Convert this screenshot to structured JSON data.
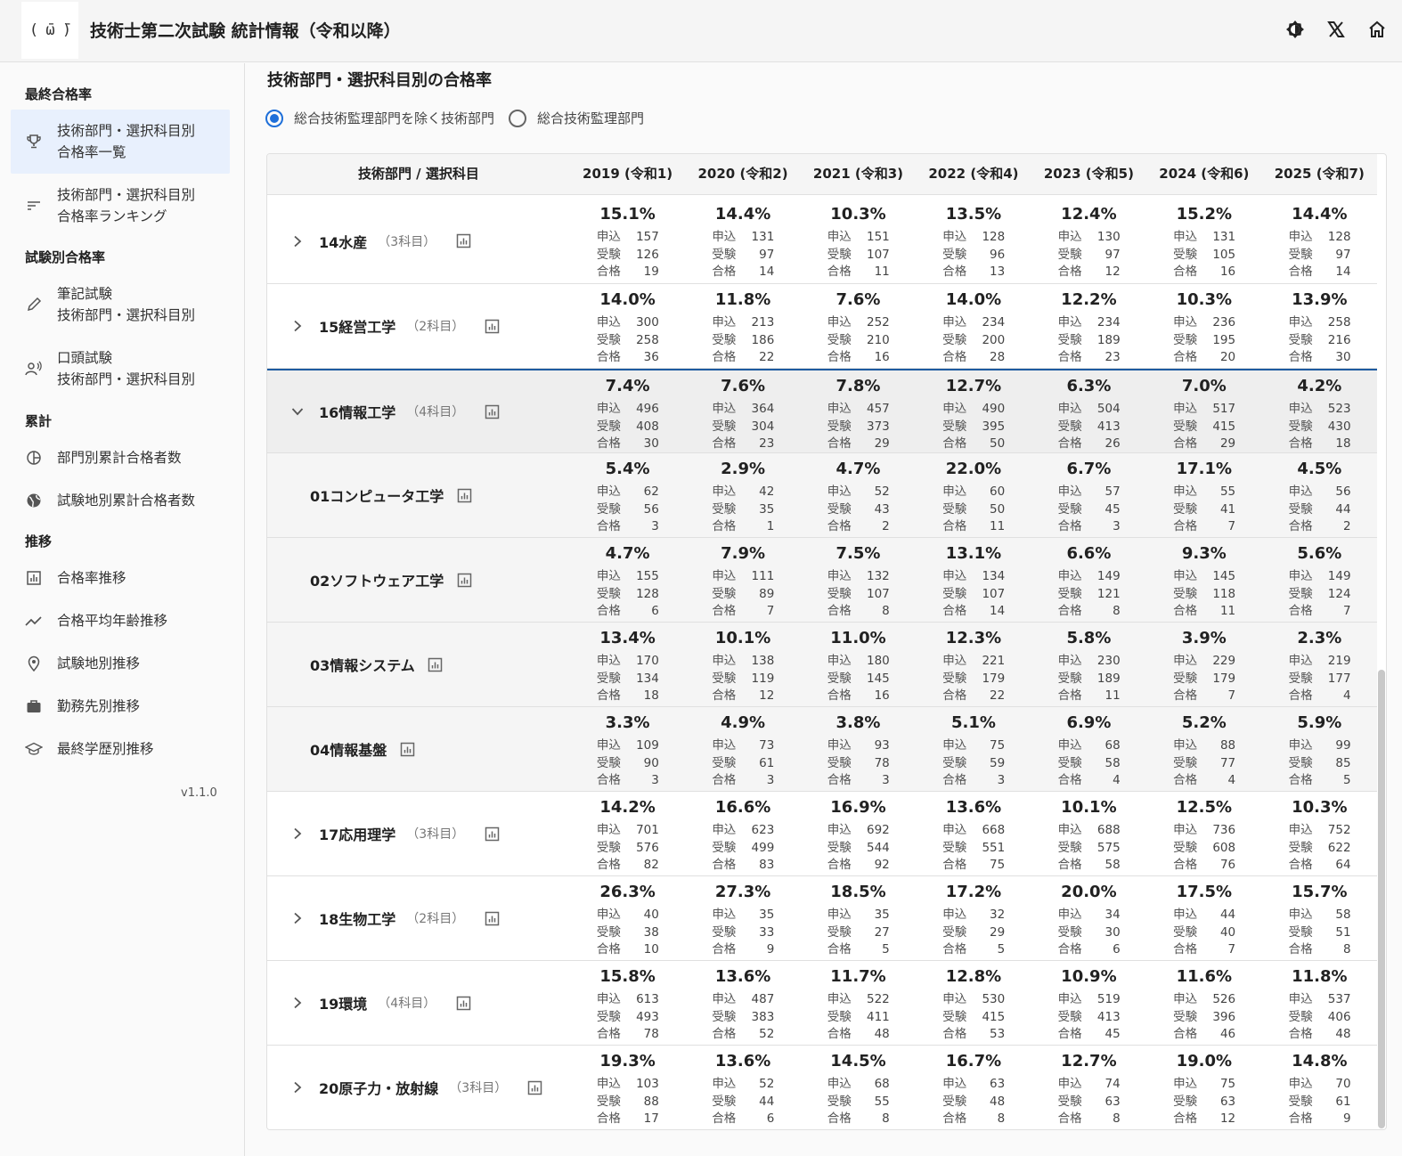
{
  "app": {
    "logo_text": "( ̄ω ̄)",
    "title": "技術士第二次試験 統計情報（令和以降）"
  },
  "appbar_icons": [
    "theme-toggle-icon",
    "x-logo-icon",
    "home-icon"
  ],
  "sidebar": {
    "sections": [
      {
        "label": "最終合格率",
        "items": [
          {
            "icon": "trophy-icon",
            "line1": "技術部門・選択科目別",
            "line2": "合格率一覧",
            "active": true
          },
          {
            "icon": "sort-icon",
            "line1": "技術部門・選択科目別",
            "line2": "合格率ランキング"
          }
        ]
      },
      {
        "label": "試験別合格率",
        "items": [
          {
            "icon": "pencil-icon",
            "line1": "筆記試験",
            "line2": "技術部門・選択科目別"
          },
          {
            "icon": "voice-icon",
            "line1": "口頭試験",
            "line2": "技術部門・選択科目別"
          }
        ]
      },
      {
        "label": "累計",
        "items": [
          {
            "icon": "pie-chart-icon",
            "line1": "部門別累計合格者数"
          },
          {
            "icon": "globe-icon",
            "line1": "試験地別累計合格者数"
          }
        ]
      },
      {
        "label": "推移",
        "items": [
          {
            "icon": "bar-chart-icon",
            "line1": "合格率推移"
          },
          {
            "icon": "trending-icon",
            "line1": "合格平均年齢推移"
          },
          {
            "icon": "location-pin-icon",
            "line1": "試験地別推移"
          },
          {
            "icon": "briefcase-icon",
            "line1": "勤務先別推移"
          },
          {
            "icon": "school-icon",
            "line1": "最終学歴別推移"
          }
        ]
      }
    ],
    "version": "v1.1.0"
  },
  "main": {
    "title": "技術部門・選択科目別の合格率",
    "radios": [
      {
        "label": "総合技術監理部門を除く技術部門",
        "checked": true
      },
      {
        "label": "総合技術監理部門",
        "checked": false
      }
    ]
  },
  "table": {
    "header_name": "技術部門 / 選択科目",
    "years": [
      "2019 (令和1)",
      "2020 (令和2)",
      "2021 (令和3)",
      "2022 (令和4)",
      "2023 (令和5)",
      "2024 (令和6)",
      "2025 (令和7)"
    ],
    "stat_labels": [
      "申込",
      "受験",
      "合格"
    ],
    "rows": [
      {
        "name": "14水産",
        "count": "（3科目）",
        "type": "dept",
        "expanded": false,
        "cells": [
          [
            "15.1%",
            157,
            126,
            19
          ],
          [
            "14.4%",
            131,
            97,
            14
          ],
          [
            "10.3%",
            151,
            107,
            11
          ],
          [
            "13.5%",
            128,
            96,
            13
          ],
          [
            "12.4%",
            130,
            97,
            12
          ],
          [
            "15.2%",
            131,
            105,
            16
          ],
          [
            "14.4%",
            128,
            97,
            14
          ]
        ]
      },
      {
        "name": "15経営工学",
        "count": "（2科目）",
        "type": "dept",
        "expanded": false,
        "cells": [
          [
            "14.0%",
            300,
            258,
            36
          ],
          [
            "11.8%",
            213,
            186,
            22
          ],
          [
            "7.6%",
            252,
            210,
            16
          ],
          [
            "14.0%",
            234,
            200,
            28
          ],
          [
            "12.2%",
            234,
            189,
            23
          ],
          [
            "10.3%",
            236,
            195,
            20
          ],
          [
            "13.9%",
            258,
            216,
            30
          ]
        ]
      },
      {
        "name": "16情報工学",
        "count": "（4科目）",
        "type": "dept",
        "expanded": true,
        "cells": [
          [
            "7.4%",
            496,
            408,
            30
          ],
          [
            "7.6%",
            364,
            304,
            23
          ],
          [
            "7.8%",
            457,
            373,
            29
          ],
          [
            "12.7%",
            490,
            395,
            50
          ],
          [
            "6.3%",
            504,
            413,
            26
          ],
          [
            "7.0%",
            517,
            415,
            29
          ],
          [
            "4.2%",
            523,
            430,
            18
          ]
        ]
      },
      {
        "name": "01コンピュータ工学",
        "type": "child",
        "cells": [
          [
            "5.4%",
            62,
            56,
            3
          ],
          [
            "2.9%",
            42,
            35,
            1
          ],
          [
            "4.7%",
            52,
            43,
            2
          ],
          [
            "22.0%",
            60,
            50,
            11
          ],
          [
            "6.7%",
            57,
            45,
            3
          ],
          [
            "17.1%",
            55,
            41,
            7
          ],
          [
            "4.5%",
            56,
            44,
            2
          ]
        ]
      },
      {
        "name": "02ソフトウェア工学",
        "type": "child",
        "cells": [
          [
            "4.7%",
            155,
            128,
            6
          ],
          [
            "7.9%",
            111,
            89,
            7
          ],
          [
            "7.5%",
            132,
            107,
            8
          ],
          [
            "13.1%",
            134,
            107,
            14
          ],
          [
            "6.6%",
            149,
            121,
            8
          ],
          [
            "9.3%",
            145,
            118,
            11
          ],
          [
            "5.6%",
            149,
            124,
            7
          ]
        ]
      },
      {
        "name": "03情報システム",
        "type": "child",
        "cells": [
          [
            "13.4%",
            170,
            134,
            18
          ],
          [
            "10.1%",
            138,
            119,
            12
          ],
          [
            "11.0%",
            180,
            145,
            16
          ],
          [
            "12.3%",
            221,
            179,
            22
          ],
          [
            "5.8%",
            230,
            189,
            11
          ],
          [
            "3.9%",
            229,
            179,
            7
          ],
          [
            "2.3%",
            219,
            177,
            4
          ]
        ]
      },
      {
        "name": "04情報基盤",
        "type": "child",
        "cells": [
          [
            "3.3%",
            109,
            90,
            3
          ],
          [
            "4.9%",
            73,
            61,
            3
          ],
          [
            "3.8%",
            93,
            78,
            3
          ],
          [
            "5.1%",
            75,
            59,
            3
          ],
          [
            "6.9%",
            68,
            58,
            4
          ],
          [
            "5.2%",
            88,
            77,
            4
          ],
          [
            "5.9%",
            99,
            85,
            5
          ]
        ]
      },
      {
        "name": "17応用理学",
        "count": "（3科目）",
        "type": "dept",
        "expanded": false,
        "cells": [
          [
            "14.2%",
            701,
            576,
            82
          ],
          [
            "16.6%",
            623,
            499,
            83
          ],
          [
            "16.9%",
            692,
            544,
            92
          ],
          [
            "13.6%",
            668,
            551,
            75
          ],
          [
            "10.1%",
            688,
            575,
            58
          ],
          [
            "12.5%",
            736,
            608,
            76
          ],
          [
            "10.3%",
            752,
            622,
            64
          ]
        ]
      },
      {
        "name": "18生物工学",
        "count": "（2科目）",
        "type": "dept",
        "expanded": false,
        "cells": [
          [
            "26.3%",
            40,
            38,
            10
          ],
          [
            "27.3%",
            35,
            33,
            9
          ],
          [
            "18.5%",
            35,
            27,
            5
          ],
          [
            "17.2%",
            32,
            29,
            5
          ],
          [
            "20.0%",
            34,
            30,
            6
          ],
          [
            "17.5%",
            44,
            40,
            7
          ],
          [
            "15.7%",
            58,
            51,
            8
          ]
        ]
      },
      {
        "name": "19環境",
        "count": "（4科目）",
        "type": "dept",
        "expanded": false,
        "cells": [
          [
            "15.8%",
            613,
            493,
            78
          ],
          [
            "13.6%",
            487,
            383,
            52
          ],
          [
            "11.7%",
            522,
            411,
            48
          ],
          [
            "12.8%",
            530,
            415,
            53
          ],
          [
            "10.9%",
            519,
            413,
            45
          ],
          [
            "11.6%",
            526,
            396,
            46
          ],
          [
            "11.8%",
            537,
            406,
            48
          ]
        ]
      },
      {
        "name": "20原子力・放射線",
        "count": "（3科目）",
        "type": "dept",
        "expanded": false,
        "cells": [
          [
            "19.3%",
            103,
            88,
            17
          ],
          [
            "13.6%",
            52,
            44,
            6
          ],
          [
            "14.5%",
            68,
            55,
            8
          ],
          [
            "16.7%",
            63,
            48,
            8
          ],
          [
            "12.7%",
            74,
            63,
            8
          ],
          [
            "19.0%",
            75,
            63,
            12
          ],
          [
            "14.8%",
            70,
            61,
            9
          ]
        ]
      }
    ]
  }
}
